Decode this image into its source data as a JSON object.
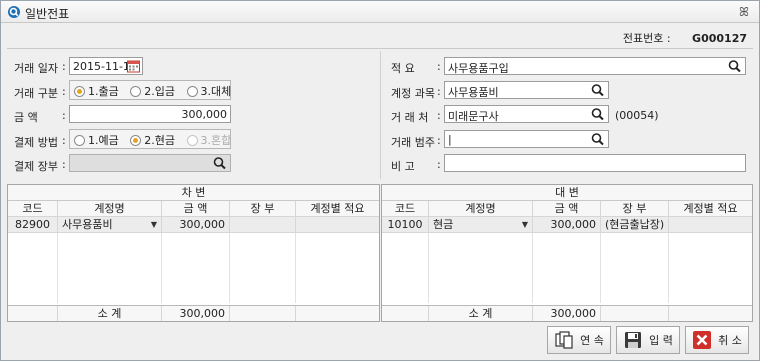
{
  "window": {
    "title": "일반전표",
    "icon": "magnifier-icon",
    "close": "ꕤ"
  },
  "voucher": {
    "label": "전표번호 :",
    "number": "G000127"
  },
  "left_form": {
    "date_label": "거래 일자",
    "date_value": "2015-11-18",
    "type_label": "거래 구분",
    "type_options": [
      "1.출금",
      "2.입금",
      "3.대체"
    ],
    "amount_label": "금      액",
    "amount_value": "300,000",
    "payment_label": "결제 방법",
    "payment_options": [
      "1.예금",
      "2.현금",
      "3.혼합"
    ],
    "ledger_label": "결제 장부",
    "ledger_value": ""
  },
  "right_form": {
    "summary_label": "적      요",
    "summary_value": "사무용품구입",
    "account_label": "계정 과목",
    "account_value": "사무용품비",
    "partner_label": "거 래 처",
    "partner_value": "미래문구사",
    "partner_code": "(00054)",
    "category_label": "거래 범주",
    "category_value": "|",
    "note_label": "비      고",
    "note_value": ""
  },
  "debit": {
    "title": "차   변",
    "headers": [
      "코드",
      "계정명",
      "금  액",
      "장 부",
      "계정별 적요"
    ],
    "row": {
      "code": "82900",
      "name": "사무용품비",
      "amount": "300,000",
      "ledger": "",
      "memo": ""
    },
    "footer": {
      "label": "소   계",
      "amount": "300,000"
    }
  },
  "credit": {
    "title": "대   변",
    "headers": [
      "코드",
      "계정명",
      "금  액",
      "장 부",
      "계정별 적요"
    ],
    "row": {
      "code": "10100",
      "name": "현금",
      "amount": "300,000",
      "ledger": "(현금출납장)",
      "memo": ""
    },
    "footer": {
      "label": "소   계",
      "amount": "300,000"
    }
  },
  "buttons": {
    "continue": "연 속",
    "enter": "입 력",
    "cancel": "취 소"
  },
  "colors": {
    "radio_selected": "#e7a21e",
    "cancel_red": "#d0302a"
  }
}
